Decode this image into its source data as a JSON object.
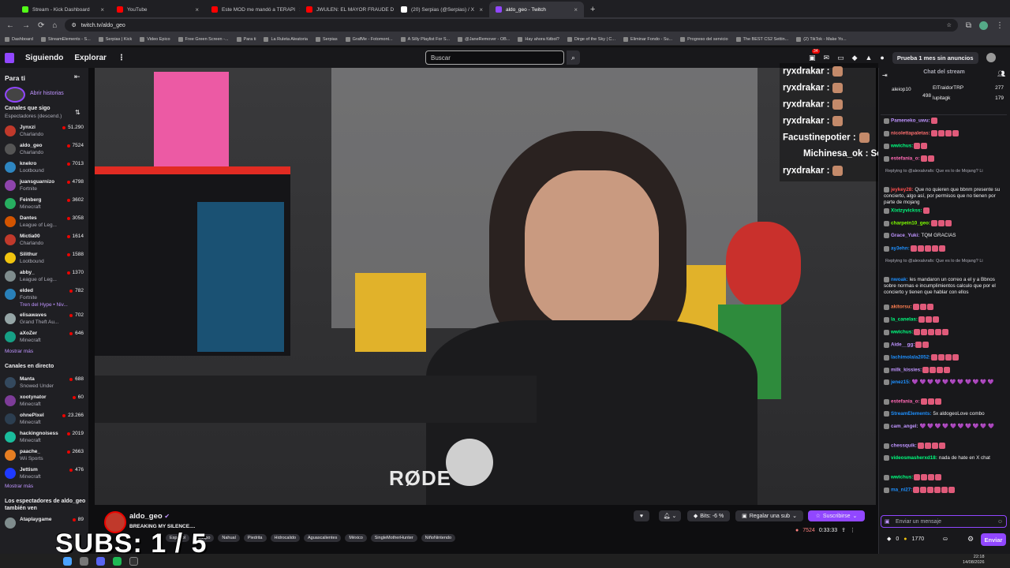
{
  "tabs": [
    {
      "title": "Stream - Kick Dashboard",
      "color": "#53fc18"
    },
    {
      "title": "YouTube",
      "color": "#ff0000"
    },
    {
      "title": "Este MOD me mandó a TERAPI",
      "color": "#ff0000"
    },
    {
      "title": "JWULEN: EL MAYOR FRAUDE D",
      "color": "#ff0000"
    },
    {
      "title": "(20) Serpias (@Serpias) / X",
      "color": "#ffffff"
    },
    {
      "title": "aldo_geo - Twitch",
      "color": "#9147ff"
    }
  ],
  "address": {
    "url": "twitch.tv/aldo_geo"
  },
  "bookmarks": [
    "Dashboard",
    "StreamElements - S...",
    "Serpias | Kick",
    "Video Epico",
    "Free Green Screen -...",
    "Para ti",
    "La Ruleta Aleatoria",
    "Serpias",
    "GrafMe - Fotomont...",
    "A Silly Playlist For S...",
    "@JaneRemover - OB...",
    "Hay ahora fútbol?",
    "Dirge of the Sky | C...",
    "Eliminar Fondo - Su...",
    "Progreso del servicio",
    "The BEST CS2 Settin...",
    "(2) TikTok - Make Yo..."
  ],
  "nav": {
    "following": "Siguiendo",
    "browse": "Explorar",
    "search_placeholder": "Buscar",
    "notif_count": "34",
    "prime": "Prueba 1 mes sin anuncios"
  },
  "sidebar": {
    "title": "Para ti",
    "history": "Abrir historias",
    "followed_header": "Canales que sigo",
    "sort": "Espectadores (descend.)",
    "followed": [
      {
        "name": "Jynxzi",
        "game": "Charlando",
        "viewers": "51.290",
        "color": "#c0392b"
      },
      {
        "name": "aldo_geo",
        "game": "Charlando",
        "viewers": "7524",
        "color": "#555"
      },
      {
        "name": "knekro",
        "game": "Lootbound",
        "viewers": "7013",
        "color": "#2e86c1"
      },
      {
        "name": "juansguarnizo",
        "game": "Fortnite",
        "viewers": "4798",
        "color": "#8e44ad"
      },
      {
        "name": "Feinberg",
        "game": "Minecraft",
        "viewers": "3602",
        "color": "#27ae60"
      },
      {
        "name": "Dantes",
        "game": "League of Leg...",
        "viewers": "3058",
        "color": "#d35400"
      },
      {
        "name": "Mictia00",
        "game": "Charlando",
        "viewers": "1614",
        "color": "#c0392b"
      },
      {
        "name": "Silithur",
        "game": "Lootbound",
        "viewers": "1588",
        "color": "#f1c40f"
      },
      {
        "name": "abby_",
        "game": "League of Leg...",
        "viewers": "1370",
        "color": "#7f8c8d"
      },
      {
        "name": "elded",
        "game": "Fortnite",
        "viewers": "782",
        "color": "#2980b9",
        "extra": "Tren del Hype • Niv..."
      },
      {
        "name": "elisawaves",
        "game": "Grand Theft Au...",
        "viewers": "702",
        "color": "#95a5a6"
      },
      {
        "name": "aXoZer",
        "game": "Minecraft",
        "viewers": "646",
        "color": "#16a085"
      }
    ],
    "more1": "Mostrar más",
    "live_header": "Canales en directo",
    "live": [
      {
        "name": "Manta",
        "game": "Snowed Under",
        "viewers": "688",
        "color": "#34495e"
      },
      {
        "name": "xootynator",
        "game": "Minecraft",
        "viewers": "60",
        "color": "#7d3c98"
      },
      {
        "name": "ohnePixel",
        "game": "Minecraft",
        "viewers": "23.266",
        "color": "#2c3e50"
      },
      {
        "name": "hackingnoisess",
        "game": "Minecraft",
        "viewers": "2019",
        "color": "#1abc9c"
      },
      {
        "name": "paache_",
        "game": "Wii Sports",
        "viewers": "2663",
        "color": "#e67e22"
      },
      {
        "name": "Jettism",
        "game": "Minecraft",
        "viewers": "476",
        "color": "#1f3aff"
      }
    ],
    "more2": "Mostrar más",
    "also_header": "Los espectadores de aldo_geo también ven",
    "also": [
      {
        "name": "Ataplaygame",
        "viewers": "89",
        "color": "#7f8c8d"
      }
    ]
  },
  "video": {
    "brand_text": "RØDE",
    "overlay_chat": [
      {
        "user": "ryxdrakar :",
        "text": ""
      },
      {
        "user": "ryxdrakar :",
        "text": ""
      },
      {
        "user": "ryxdrakar :",
        "text": ""
      },
      {
        "user": "ryxdrakar :",
        "text": ""
      },
      {
        "user": "Facustinepotier :",
        "text": ""
      },
      {
        "user": "Michinesa_ok :",
        "text": "See"
      },
      {
        "user": "ryxdrakar :",
        "text": ""
      }
    ],
    "subs_overlay": "SUBS: 1 / 5"
  },
  "stream": {
    "name": "aldo_geo",
    "title": "BREAKING MY SILENCE....",
    "tags": [
      "Español",
      "Guapo",
      "Nahual",
      "Piedrita",
      "Hidrocalido",
      "Aguascalientes",
      "México",
      "SingleMotherHunter",
      "NiñoNintendo"
    ],
    "bits": "Bits: -6 %",
    "gift": "Regalar una sub",
    "subscribe": "Suscribirse",
    "viewers": "7524",
    "uptime": "0:33:33"
  },
  "chat": {
    "header": "Chat del stream",
    "leaders": [
      {
        "name": "aleiop10",
        "score": "498"
      },
      {
        "name": "ElTraidorTRP",
        "score": "277"
      },
      {
        "name": "lupitagk",
        "score": "179"
      }
    ],
    "messages": [
      {
        "user": "Pameneko_uwu:",
        "color": "#bf94ff",
        "text": "",
        "emotes": 1
      },
      {
        "user": "nicolettapaletas:",
        "color": "#ff6e6e",
        "text": "",
        "emotes": 4
      },
      {
        "user": "wwichus:",
        "color": "#00ff7f",
        "text": "",
        "emotes": 2
      },
      {
        "user": "estefania_o:",
        "color": "#ff69b4",
        "text": "",
        "emotes": 2
      },
      {
        "user": "",
        "color": "#adadb8",
        "text": "Replying to @alexalvrafs: Que es lo de Mojang? Li",
        "emotes": 0
      },
      {
        "user": "jeykey28:",
        "color": "#ff4f4f",
        "text": "Que no quieren que bbnm presente su concierto, algo así, por permisos que no tienen por parte de mojang",
        "emotes": 0
      },
      {
        "user": "Xixtzyvickss:",
        "color": "#00ff7f",
        "text": "",
        "emotes": 1
      },
      {
        "user": "charpein10_geo:",
        "color": "#7fff00",
        "text": "",
        "emotes": 3
      },
      {
        "user": "Grace_Yuki:",
        "color": "#bf94ff",
        "text": "TQM GRACIAS",
        "emotes": 0
      },
      {
        "user": "ay3ehn:",
        "color": "#1e90ff",
        "text": "",
        "emotes": 5
      },
      {
        "user": "",
        "color": "#adadb8",
        "text": "Replying to @alexalvrafs: Que es lo de Mojang? Li",
        "emotes": 0
      },
      {
        "user": "nwoak:",
        "color": "#1e90ff",
        "text": "les mandaron un correo a el y a Bbnos sobre normas e incumplimientos calculo que por el concierto y tienen que hablar con ellos",
        "emotes": 0
      },
      {
        "user": "akitorsu:",
        "color": "#ff7f50",
        "text": "",
        "emotes": 3
      },
      {
        "user": "la_canelas:",
        "color": "#00ff7f",
        "text": "",
        "emotes": 3
      },
      {
        "user": "wwichus:",
        "color": "#00ff7f",
        "text": "",
        "emotes": 5
      },
      {
        "user": "Aide__gg:",
        "color": "#bf94ff",
        "text": "",
        "emotes": 2
      },
      {
        "user": "lachimolala2052:",
        "color": "#1e90ff",
        "text": "",
        "emotes": 4
      },
      {
        "user": "milk_kissies:",
        "color": "#bf94ff",
        "text": "",
        "emotes": 4
      },
      {
        "user": "jenez15:",
        "color": "#1e90ff",
        "text": "💜 💜 💜 💜 💜 💜 💜 💜 💜 💜 💜",
        "emotes": 0
      },
      {
        "user": "estefania_o:",
        "color": "#ff69b4",
        "text": "",
        "emotes": 3
      },
      {
        "user": "StreamElements:",
        "color": "#1e90ff",
        "text": "5x aldogeoLove combo",
        "emotes": 0
      },
      {
        "user": "cam_angel:",
        "color": "#bf94ff",
        "text": "💜 💜 💜 💜 💜 💜 💜 💜 💜 💜",
        "emotes": 0
      },
      {
        "user": "chessquik:",
        "color": "#bf94ff",
        "text": "",
        "emotes": 4
      },
      {
        "user": "videosmasherxd18:",
        "color": "#00ff7f",
        "text": "nada de hate en X chat",
        "emotes": 0
      },
      {
        "user": "wwichus:",
        "color": "#00ff7f",
        "text": "",
        "emotes": 4
      },
      {
        "user": "ma_ni27:",
        "color": "#1e90ff",
        "text": "",
        "emotes": 6
      }
    ],
    "input_placeholder": "Enviar un mensaje",
    "points_bits": "0",
    "points": "1770",
    "send": "Enviar"
  },
  "clock": {
    "time": "22:18",
    "date": "14/08/2026"
  }
}
